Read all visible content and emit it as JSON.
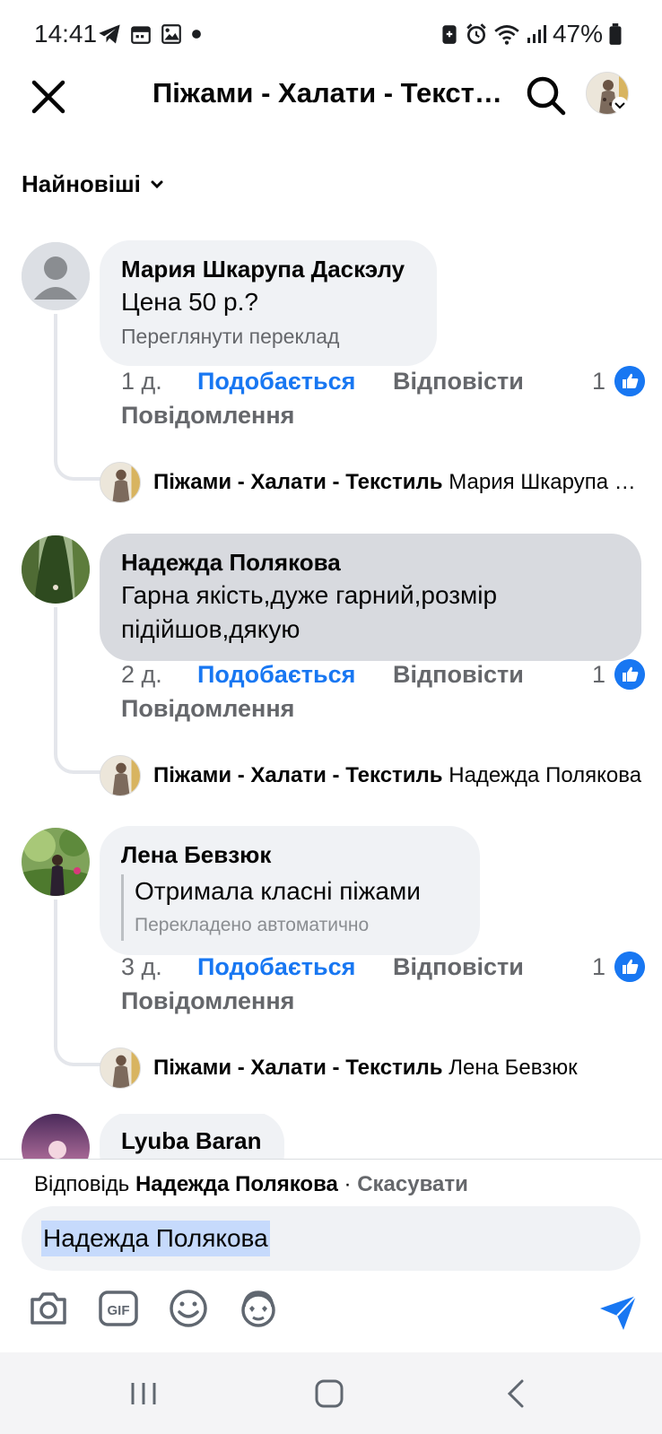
{
  "status_bar": {
    "time": "14:41",
    "battery": "47%",
    "icons": [
      "telegram-icon",
      "calendar-icon",
      "gallery-icon",
      "dot-icon",
      "battery-saver-icon",
      "alarm-icon",
      "wifi-icon",
      "signal-icon",
      "battery-icon"
    ]
  },
  "header": {
    "title": "Піжами - Халати - Текстиль"
  },
  "sort": {
    "label": "Найновіші"
  },
  "comments": [
    {
      "author": "Мария Шкарупа Даскэлу",
      "text": "Цена  50 р.?",
      "subtext": "Переглянути переклад",
      "time": "1 д.",
      "like_label": "Подобається",
      "reply_label": "Відповісти",
      "message_label": "Повідомлення",
      "like_count": "1",
      "reply_author": "Піжами - Халати - Текстиль",
      "reply_preview": "Мария Шкарупа Даскэлу"
    },
    {
      "author": "Надежда Полякова",
      "text": "Гарна якість,дуже гарний,розмір підійшов,дякую",
      "time": "2 д.",
      "like_label": "Подобається",
      "reply_label": "Відповісти",
      "message_label": "Повідомлення",
      "like_count": "1",
      "reply_author": "Піжами - Халати - Текстиль",
      "reply_preview": "Надежда Полякова"
    },
    {
      "author": "Лена Бевзюк",
      "text": "Отримала класні піжами",
      "subtext": "Перекладено автоматично",
      "time": "3 д.",
      "like_label": "Подобається",
      "reply_label": "Відповісти",
      "message_label": "Повідомлення",
      "like_count": "1",
      "reply_author": "Піжами - Халати - Текстиль",
      "reply_preview": "Лена Бевзюк"
    },
    {
      "author": "Lyuba Baran"
    }
  ],
  "compose": {
    "reply_prefix": "Відповідь",
    "reply_to": "Надежда Полякова",
    "separator": " · ",
    "cancel": "Скасувати",
    "input_value": "Надежда Полякова",
    "tools": [
      "camera-icon",
      "gif-icon",
      "emoji-icon",
      "avatar-sticker-icon",
      "send-icon"
    ]
  },
  "colors": {
    "accent": "#1877f2",
    "bubble": "#f0f2f5",
    "bubble_highlight": "#d8dadf",
    "secondary_text": "#65676b"
  }
}
